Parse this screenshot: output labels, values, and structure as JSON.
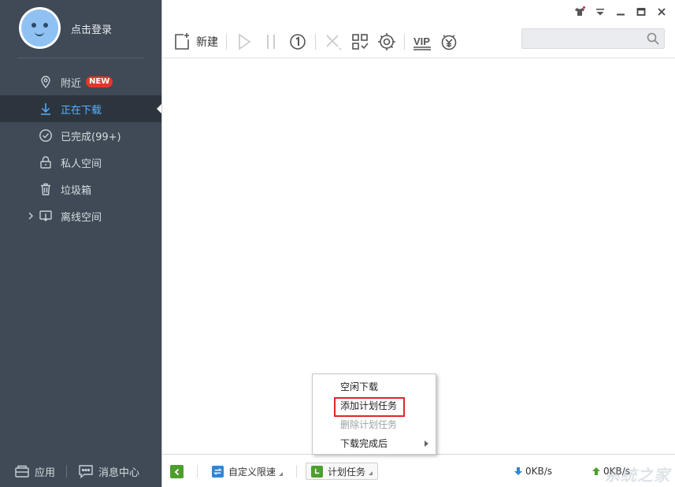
{
  "user": {
    "login_text": "点击登录"
  },
  "nav": {
    "items": [
      {
        "label": "附近",
        "badge": "NEW"
      },
      {
        "label": "正在下载"
      },
      {
        "label": "已完成(99+)"
      },
      {
        "label": "私人空间"
      },
      {
        "label": "垃圾箱"
      },
      {
        "label": "离线空间"
      }
    ]
  },
  "sidebar_bottom": {
    "apps_label": "应用",
    "messages_label": "消息中心"
  },
  "toolbar": {
    "new_label": "新建",
    "vip_label": "VIP",
    "search_placeholder": ""
  },
  "statusbar": {
    "speed_limit_label": "自定义限速",
    "schedule_label": "计划任务",
    "download_speed": "0KB/s",
    "upload_speed": "0KB/s"
  },
  "context_menu": {
    "items": [
      {
        "label": "空闲下载"
      },
      {
        "label": "添加计划任务"
      },
      {
        "label": "删除计划任务"
      },
      {
        "label": "下载完成后"
      }
    ]
  },
  "watermark": "系统之家",
  "colors": {
    "sidebar_bg": "#3f4a56",
    "active_nav": "#5ab0ff",
    "badge_red": "#e2372b",
    "highlight_box": "#e2252b",
    "green_accent": "#4d9f2c",
    "blue_accent": "#2f86d6"
  }
}
